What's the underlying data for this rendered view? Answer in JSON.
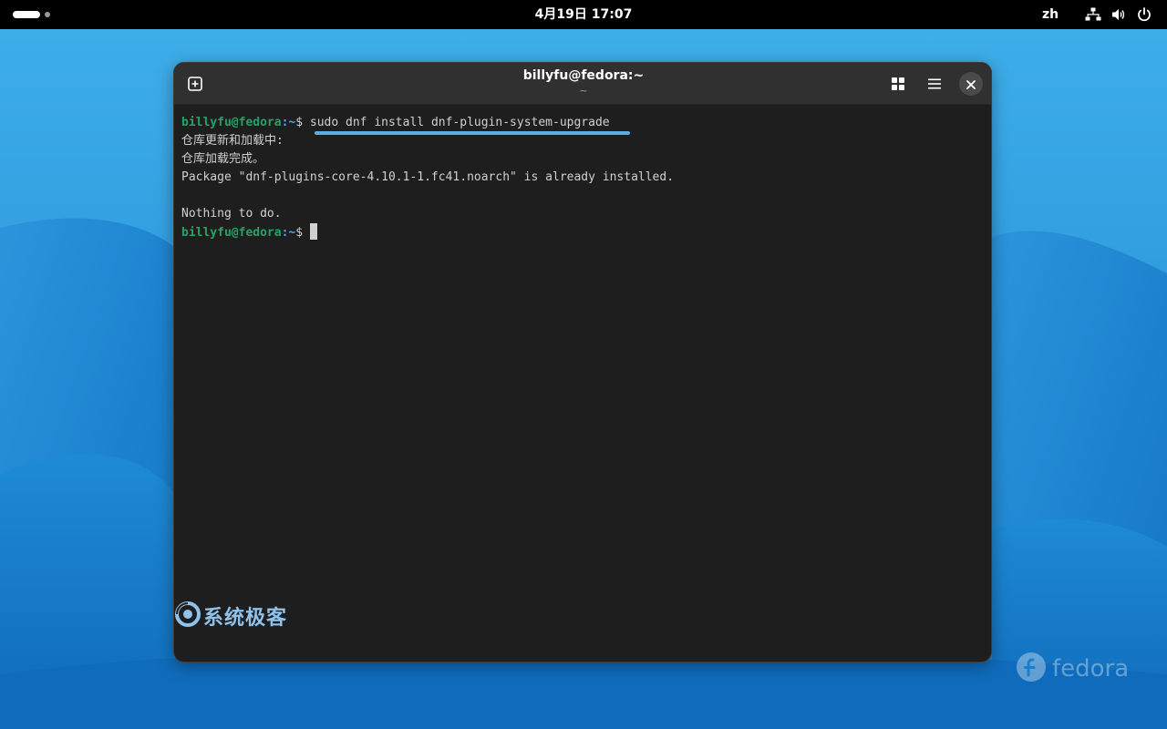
{
  "topbar": {
    "clock": "4月19日  17:07",
    "input_language": "zh",
    "icons": [
      "network-icon",
      "volume-icon",
      "power-icon"
    ]
  },
  "window": {
    "title": "billyfu@fedora:~",
    "subtitle": "~",
    "buttons": [
      "new-tab-icon",
      "tab-overview-icon",
      "menu-icon",
      "close-icon"
    ]
  },
  "terminal": {
    "prompt_user": "billyfu@fedora",
    "prompt_path": ":~",
    "prompt_symbol": "$ ",
    "command": "sudo dnf install dnf-plugin-system-upgrade",
    "output": [
      "仓库更新和加载中:",
      "仓库加载完成。",
      "Package \"dnf-plugins-core-4.10.1-1.fc41.noarch\" is already installed.",
      "",
      "Nothing to do."
    ],
    "highlight_color": "#5aaee6"
  },
  "watermark": {
    "text": "系统极客"
  },
  "wallpaper": {
    "logo_text": "fedora"
  },
  "colors": {
    "prompt_user": "#26a269",
    "prompt_path": "#5fa0e6",
    "terminal_bg": "#1e1e1e",
    "headerbar_bg": "#303030"
  }
}
